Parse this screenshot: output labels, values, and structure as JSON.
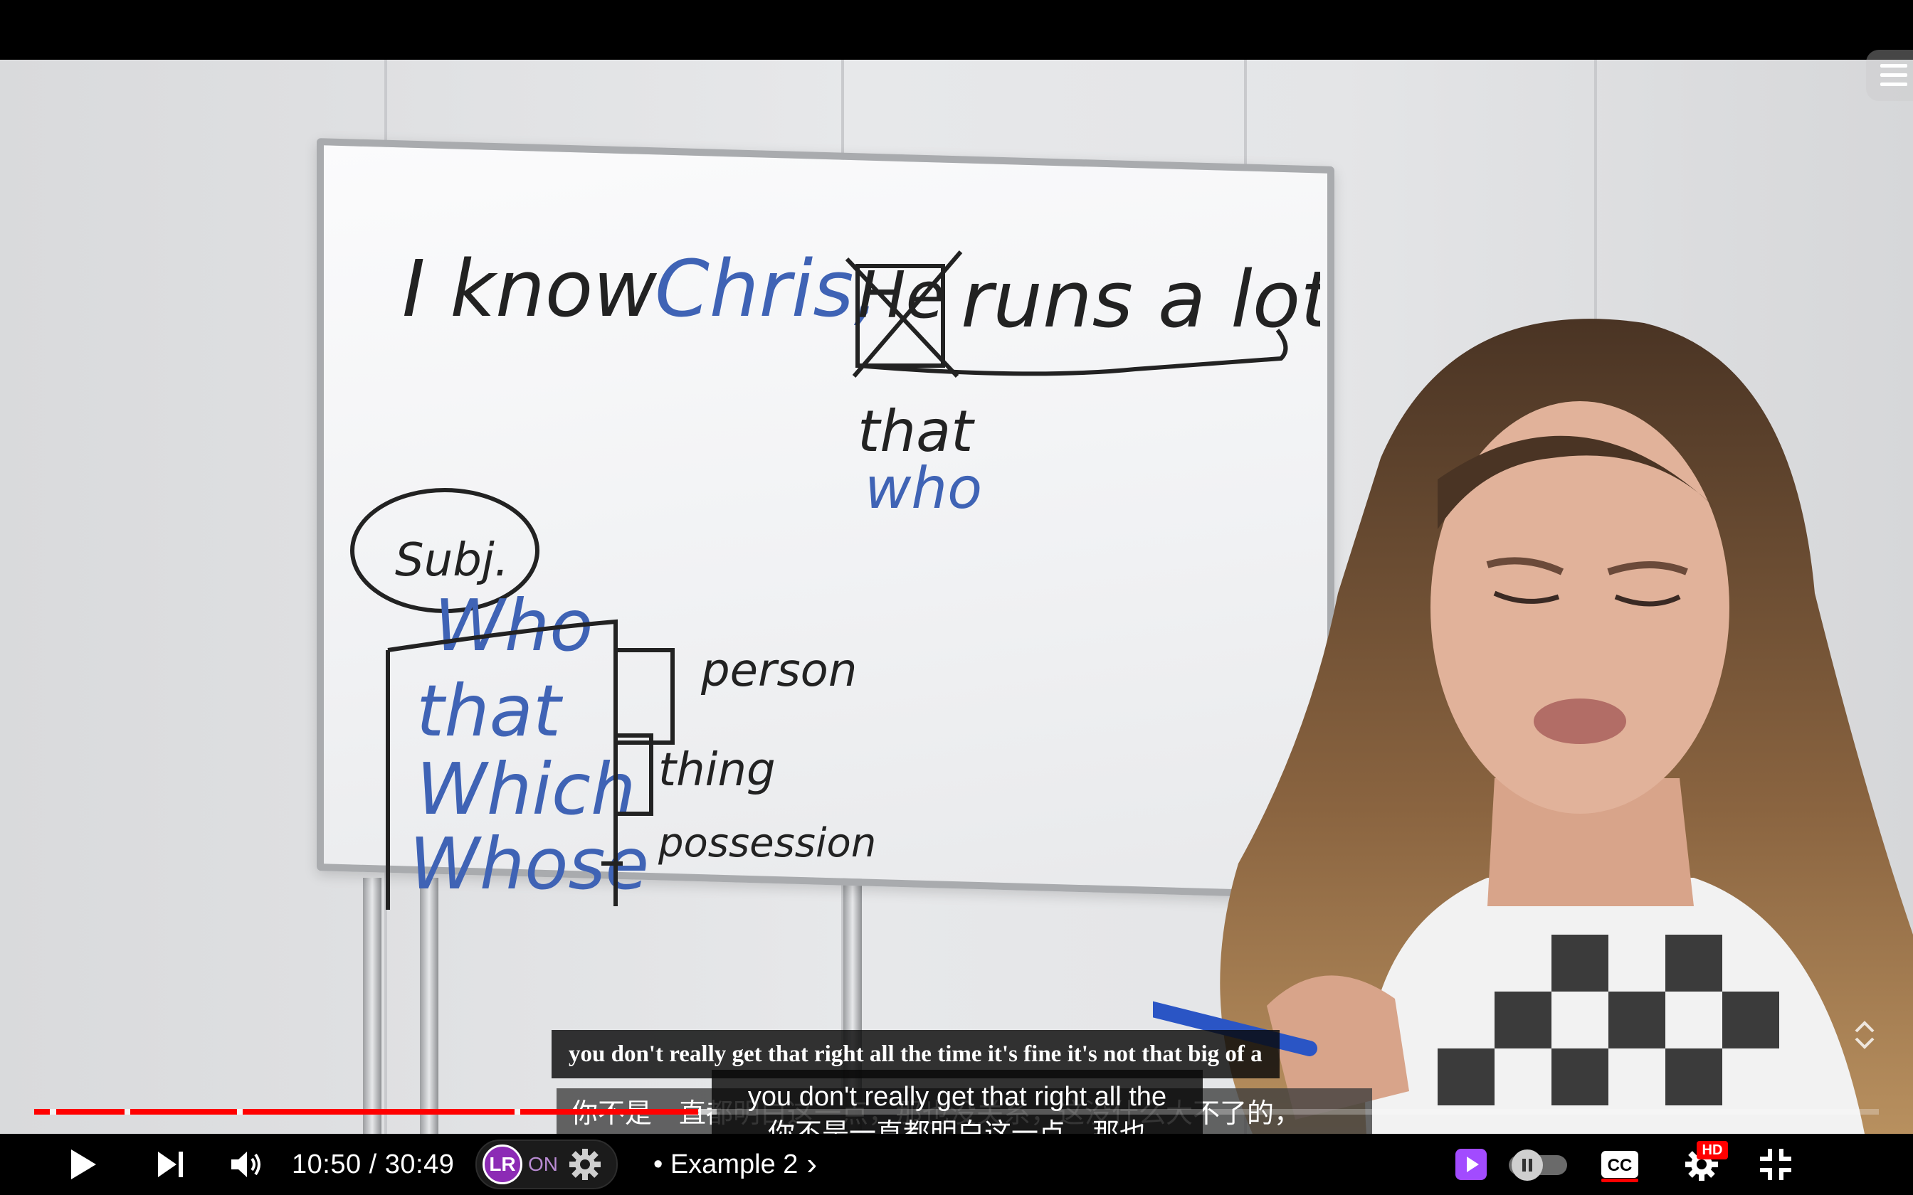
{
  "video": {
    "whiteboard_text": {
      "sentence": [
        "I know",
        "Chris,",
        "He",
        "runs a lot."
      ],
      "replacements": [
        "that",
        "who"
      ],
      "circled": "Subj.",
      "pronouns": [
        "Who",
        "that",
        "Which",
        "Whose"
      ],
      "categories": [
        "person",
        "thing",
        "possession"
      ]
    }
  },
  "subtitles": {
    "english_full": "you don't really get that right all the time it's fine it's not that big of a",
    "chinese_full": "你不是一直都明白这一点，那也没关系，这没什么大不了的，",
    "overlay_english": "you don't really get that right all the",
    "overlay_chinese": "你不是一直都明白这一点，那也"
  },
  "progress": {
    "played_fraction": 0.36,
    "buffered_fraction": 0.37
  },
  "controls": {
    "play_icon": "play-icon",
    "next_icon": "skip-next-icon",
    "volume_icon": "volume-icon",
    "time_display": "10:50 / 30:49",
    "extension_logo": "LR",
    "extension_status": "ON",
    "chapter_label": "• Example 2",
    "chapter_arrow": "›",
    "hd_badge": "HD"
  },
  "colors": {
    "progress_played": "#ff0000",
    "extension_purple": "#8c2bb5",
    "miniplayer_purple": "#a24bff"
  }
}
